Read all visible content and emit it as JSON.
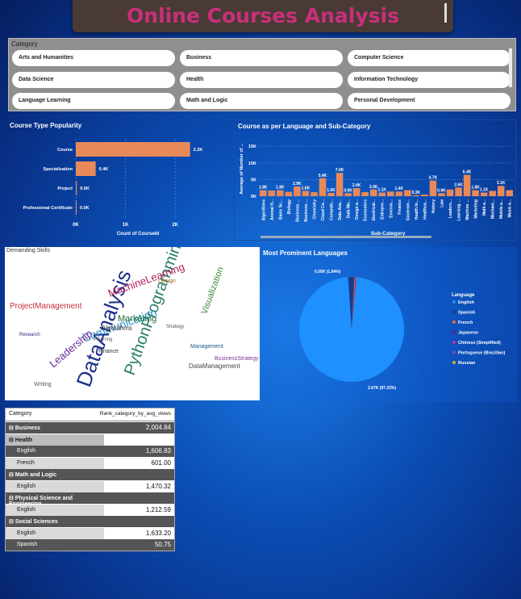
{
  "title": "Online Courses Analysis",
  "category_slicer": {
    "header": "Category",
    "items": [
      "Arts and Humanities",
      "Business",
      "Computer Science",
      "Data Science",
      "Health",
      "Information Technology",
      "Language Learning",
      "Math and Logic",
      "Personal Development"
    ]
  },
  "course_type": {
    "title": "Course Type Popularity",
    "xlabel": "Count of CourseId",
    "categories": [
      "Course",
      "Specialization",
      "Project",
      "Professional Certificate"
    ],
    "value_labels": [
      "2.3K",
      "0.4K",
      "0.0K",
      "0.0K"
    ],
    "ticks": [
      "0K",
      "1K",
      "2K"
    ],
    "chart_data": {
      "type": "bar",
      "categories": [
        "Course",
        "Specialization",
        "Project",
        "Professional Certificate"
      ],
      "values": [
        2300,
        400,
        20,
        10
      ],
      "xlim": [
        0,
        2500
      ]
    }
  },
  "lang_subcat": {
    "title": "Course as per Language and Sub-Category",
    "ylabel": "Average of Number of ...",
    "xlabel": "Sub-Category",
    "yticks": [
      "15K",
      "10K",
      "5K",
      "0K"
    ],
    "chart_data": {
      "type": "bar",
      "categories": [
        "Algorithms",
        "Animal H...",
        "Basic Sc...",
        "Biology",
        "Business ...",
        "Business ...",
        "Chemistry",
        "Cloud Co...",
        "Compute...",
        "Data Ana...",
        "Data Ma...",
        "Design a...",
        "Economics",
        "Electrical...",
        "Entrepre...",
        "Environ...",
        "Finance",
        "Governm...",
        "Health In...",
        "Healthca...",
        "History",
        "Law",
        "Leaders...",
        "Learning ...",
        "Machine ...",
        "Marketing",
        "Math a...",
        "Mechani...",
        "Mobile a...",
        "Music a..."
      ],
      "values": [
        1800,
        1700,
        1800,
        1300,
        2900,
        1600,
        1200,
        5400,
        1000,
        7000,
        900,
        2400,
        1200,
        2000,
        1100,
        1400,
        1400,
        1800,
        300,
        500,
        4700,
        900,
        2000,
        2600,
        6400,
        1800,
        1100,
        1600,
        3100,
        1800
      ],
      "ylim": [
        0,
        17000
      ]
    },
    "value_labels": [
      "1.8K",
      "",
      "1.8K",
      "",
      "2.9K",
      "1.6K",
      "",
      "5.4K",
      "1.0K",
      "7.0K",
      "0.9K",
      "2.4K",
      "",
      "2.0K",
      "1.1K",
      "",
      "1.4K",
      "",
      "0.3K",
      "",
      "4.7K",
      "0.9K",
      "",
      "2.6K",
      "6.4K",
      "1.8K",
      "1.1K",
      "",
      "3.1K",
      ""
    ]
  },
  "skills": {
    "title": "Demanding Skills",
    "words": [
      {
        "t": "DataAnalysis",
        "c": "#1a2f8a"
      },
      {
        "t": "PythonProgramming",
        "c": "#2a7d6a"
      },
      {
        "t": "MachineLearning",
        "c": "#b01c5a"
      },
      {
        "t": "Communication",
        "c": "#2a8fc7"
      },
      {
        "t": "ProjectManagement",
        "c": "#c8303a"
      },
      {
        "t": "Leadership",
        "c": "#6a2a9a"
      },
      {
        "t": "Marketing",
        "c": "#1f6b2d"
      },
      {
        "t": "Visualization",
        "c": "#3d8a3a"
      },
      {
        "t": "DataManagement",
        "c": "#444"
      },
      {
        "t": "BusinessStrategy",
        "c": "#7a3a9a"
      },
      {
        "t": "Algorithms",
        "c": "#333"
      },
      {
        "t": "Design",
        "c": "#9a6a1a"
      },
      {
        "t": "Writing",
        "c": "#555"
      },
      {
        "t": "Finance",
        "c": "#333"
      },
      {
        "t": "Management",
        "c": "#1a5a8a"
      },
      {
        "t": "Planning",
        "c": "#5a5a5a"
      },
      {
        "t": "Strategy",
        "c": "#555"
      },
      {
        "t": "Research",
        "c": "#2a2a8a"
      }
    ]
  },
  "languages": {
    "title": "Most Prominent Languages",
    "legend_title": "Language",
    "legend": [
      {
        "name": "English",
        "color": "#1e90ff"
      },
      {
        "name": "Spanish",
        "color": "#1a3a8a"
      },
      {
        "name": "French",
        "color": "#e0703a"
      },
      {
        "name": "Japanese",
        "color": "#6a1a8a"
      },
      {
        "name": "Chinese (Simplified)",
        "color": "#d02aa0"
      },
      {
        "name": "Portuguese (Brazilian)",
        "color": "#7a4ac8"
      },
      {
        "name": "Russian",
        "color": "#c8b02a"
      }
    ],
    "label_small": "0.05K (1.94%)",
    "label_big": "2.67K (97.33%)",
    "chart_data": {
      "type": "pie",
      "categories": [
        "English",
        "Spanish",
        "French",
        "Japanese",
        "Chinese (Simplified)",
        "Portuguese (Brazilian)",
        "Russian"
      ],
      "values": [
        97.33,
        1.94,
        0.3,
        0.15,
        0.12,
        0.1,
        0.06
      ]
    }
  },
  "matrix": {
    "col1": "Category",
    "col2": "Rank_category_by_avg_views",
    "rows": [
      {
        "label": "Business",
        "value": "2,004.84",
        "level": 0,
        "style": "dark"
      },
      {
        "label": "Health",
        "value": "",
        "level": 0,
        "style": "grey"
      },
      {
        "label": "English",
        "value": "1,606.83",
        "level": 1,
        "style": "dark"
      },
      {
        "label": "French",
        "value": "601.00",
        "level": 1,
        "style": "light"
      },
      {
        "label": "Math and Logic",
        "value": "",
        "level": 0,
        "style": "dark"
      },
      {
        "label": "English",
        "value": "1,470.32",
        "level": 1,
        "style": "light"
      },
      {
        "label": "Physical Science and Engineering",
        "value": "",
        "level": 0,
        "style": "dark"
      },
      {
        "label": "English",
        "value": "1,212.59",
        "level": 1,
        "style": "light"
      },
      {
        "label": "Social Sciences",
        "value": "",
        "level": 0,
        "style": "dark"
      },
      {
        "label": "English",
        "value": "1,633.20",
        "level": 1,
        "style": "light"
      },
      {
        "label": "Spanish",
        "value": "50.75",
        "level": 1,
        "style": "dark"
      }
    ]
  }
}
